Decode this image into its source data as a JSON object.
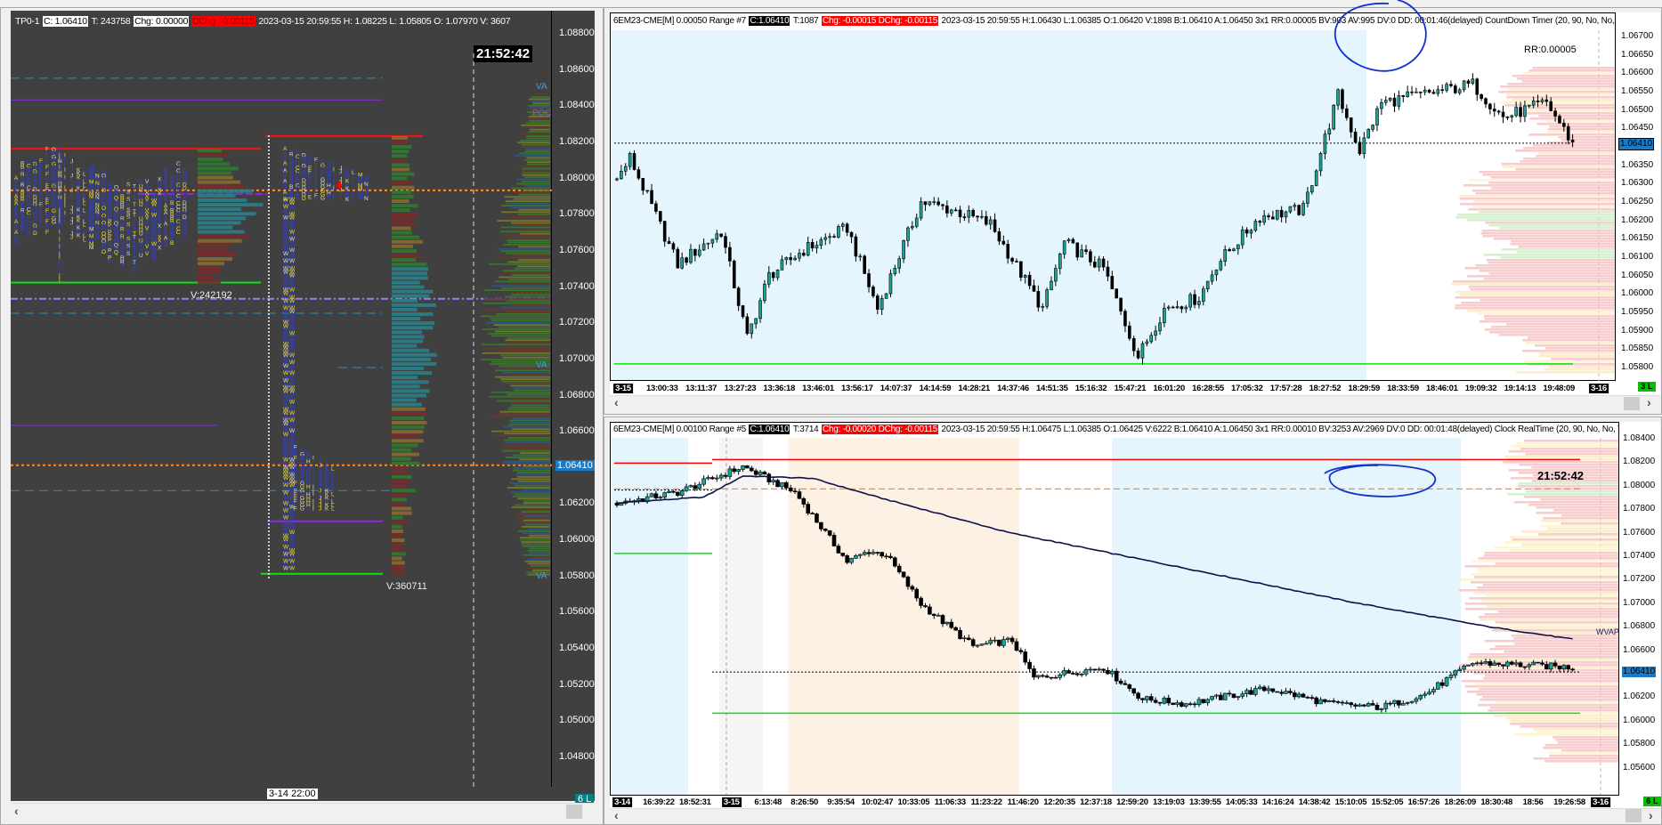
{
  "left_chart": {
    "header": {
      "name": "TP0-1",
      "close": "C: 1.06410",
      "ticks": "T: 243758",
      "chg": "Chg: 0.00000",
      "dchg": "DChg: -0.00115",
      "info": "2023-03-15 20:59:55 H: 1.08225 L: 1.05805 O: 1.07970 V: 3607"
    },
    "clock": "21:52:42",
    "price_axis": [
      "1.08800",
      "1.08600",
      "1.08400",
      "1.08200",
      "1.08000",
      "1.07800",
      "1.07600",
      "1.07400",
      "1.07200",
      "1.07000",
      "1.06800",
      "1.06600",
      "1.06400",
      "1.06200",
      "1.06000",
      "1.05800",
      "1.05600",
      "1.05400",
      "1.05200",
      "1.05000",
      "1.04800"
    ],
    "last_price": "1.06410",
    "labels": {
      "vol1": "V:242192",
      "vol2": "V:360711",
      "va1": "VA",
      "poc": "POC",
      "va2": "VA",
      "va3": "VA"
    },
    "time_label": "3-14  22:00",
    "corner": "6 L",
    "colors": {
      "bg": "#404040",
      "red": "#ff1010",
      "green": "#10e010",
      "purple": "#8a2be2",
      "orange": "#ff8c28",
      "blue_dash": "#2a8cc0"
    }
  },
  "top_chart": {
    "header": {
      "symbol": "6EM23-CME[M]  0.00050 Range  #7",
      "close": "C:1.06410",
      "ticks": "T:1087",
      "chg": "Chg: -0.00015 DChg: -0.00115",
      "info": "2023-03-15 20:59:55 H:1.06430 L:1.06385 O:1.06420 V:1898 B:1.06410 A:1.06450 3x1 RR:0.00005 BV:903 AV:995 DV:0 DD: 00:01:46(delayed) CountDown Timer   (20, 90, No, No, No, No, No, No, No, Yes"
    },
    "rr": "RR:0.00005",
    "price_axis": [
      "1.06700",
      "1.06650",
      "1.06600",
      "1.06550",
      "1.06500",
      "1.06450",
      "1.06400",
      "1.06350",
      "1.06300",
      "1.06250",
      "1.06200",
      "1.06150",
      "1.06100",
      "1.06050",
      "1.06000",
      "1.05950",
      "1.05900",
      "1.05850",
      "1.05800"
    ],
    "last_price": "1.06410",
    "time_axis": [
      "3-15",
      "13:00:33",
      "13:11:37",
      "13:27:23",
      "13:36:18",
      "13:46:01",
      "13:56:17",
      "14:07:37",
      "14:14:59",
      "14:28:21",
      "14:37:46",
      "14:51:35",
      "15:16:32",
      "15:47:21",
      "16:01:20",
      "16:28:55",
      "17:05:32",
      "17:57:28",
      "18:27:52",
      "18:29:59",
      "18:33:59",
      "18:46:01",
      "19:09:32",
      "19:14:13",
      "19:48:09"
    ],
    "end_date": "3-16",
    "corner": "3 L",
    "bars": 220,
    "price_keypoints": [
      [
        0,
        1.0631
      ],
      [
        3,
        1.0637
      ],
      [
        14,
        1.0608
      ],
      [
        24,
        1.0617
      ],
      [
        30,
        1.0588
      ],
      [
        35,
        1.0605
      ],
      [
        43,
        1.0612
      ],
      [
        53,
        1.0618
      ],
      [
        60,
        1.0596
      ],
      [
        70,
        1.0625
      ],
      [
        77,
        1.0623
      ],
      [
        86,
        1.0619
      ],
      [
        98,
        1.0596
      ],
      [
        103,
        1.0614
      ],
      [
        112,
        1.0607
      ],
      [
        120,
        1.0583
      ],
      [
        126,
        1.0596
      ],
      [
        134,
        1.0599
      ],
      [
        138,
        1.0608
      ],
      [
        148,
        1.0621
      ],
      [
        158,
        1.0623
      ],
      [
        166,
        1.0654
      ],
      [
        171,
        1.0639
      ],
      [
        176,
        1.0652
      ],
      [
        197,
        1.0657
      ],
      [
        204,
        1.0648
      ],
      [
        214,
        1.0652
      ],
      [
        220,
        1.0641
      ]
    ],
    "levels": {
      "green": 1.0581,
      "last": 1.0641
    }
  },
  "bottom_chart": {
    "header": {
      "symbol": "6EM23-CME[M]  0.00100 Range  #5",
      "close": "C:1.06410",
      "ticks": "T:3714",
      "chg": "Chg: -0.00020 DChg: -0.00115",
      "info": "2023-03-15 20:59:55 H:1.06475 L:1.06385 O:1.06425 V:6222 B:1.06410 A:1.06450 3x1 RR:0.00010 BV:3253 AV:2969 DV:0 DD: 00:01:48(delayed) Clock   RealTime   (20, 90, No, No, Yes, No, 0)  Volume Weigh"
    },
    "clock": "21:52:42",
    "vwap_label": "WVAP",
    "price_axis": [
      "1.08400",
      "1.08200",
      "1.08000",
      "1.07800",
      "1.07600",
      "1.07400",
      "1.07200",
      "1.07000",
      "1.06800",
      "1.06600",
      "1.06400",
      "1.06200",
      "1.06000",
      "1.05800",
      "1.05600"
    ],
    "last_price": "1.06410",
    "time_axis": [
      "3-14",
      "16:39:22",
      "18:52:31",
      "3-15",
      "6:13:48",
      "8:26:50",
      "9:35:54",
      "10:02:47",
      "10:33:05",
      "11:06:33",
      "11:23:22",
      "11:46:20",
      "12:20:35",
      "12:37:18",
      "12:59:20",
      "13:19:03",
      "13:39:55",
      "14:05:33",
      "14:16:24",
      "14:38:42",
      "15:10:05",
      "15:52:05",
      "16:57:26",
      "18:26:09",
      "18:30:48",
      "18:56",
      "19:26:58"
    ],
    "end_date": "3-16",
    "corner": "6 L",
    "bars": 220,
    "price_keypoints": [
      [
        0,
        1.0785
      ],
      [
        14,
        1.0794
      ],
      [
        29,
        1.0816
      ],
      [
        41,
        1.0794
      ],
      [
        53,
        1.0735
      ],
      [
        58,
        1.0744
      ],
      [
        62,
        1.0741
      ],
      [
        70,
        1.0699
      ],
      [
        82,
        1.0663
      ],
      [
        91,
        1.0668
      ],
      [
        96,
        1.0636
      ],
      [
        112,
        1.0645
      ],
      [
        121,
        1.0618
      ],
      [
        131,
        1.0614
      ],
      [
        150,
        1.0627
      ],
      [
        164,
        1.0614
      ],
      [
        176,
        1.0611
      ],
      [
        186,
        1.0622
      ],
      [
        197,
        1.0649
      ],
      [
        220,
        1.0645
      ]
    ],
    "vwap_keypoints": [
      [
        0,
        1.0785
      ],
      [
        20,
        1.079
      ],
      [
        29,
        1.0808
      ],
      [
        45,
        1.0806
      ],
      [
        60,
        1.079
      ],
      [
        90,
        1.076
      ],
      [
        130,
        1.073
      ],
      [
        170,
        1.07
      ],
      [
        200,
        1.068
      ],
      [
        220,
        1.0669
      ]
    ],
    "levels": {
      "red": 1.0822,
      "orange": 1.0797,
      "last": 1.0641,
      "green": 1.0606,
      "green_left": 1.0742,
      "prior_close": 1.0796
    }
  }
}
